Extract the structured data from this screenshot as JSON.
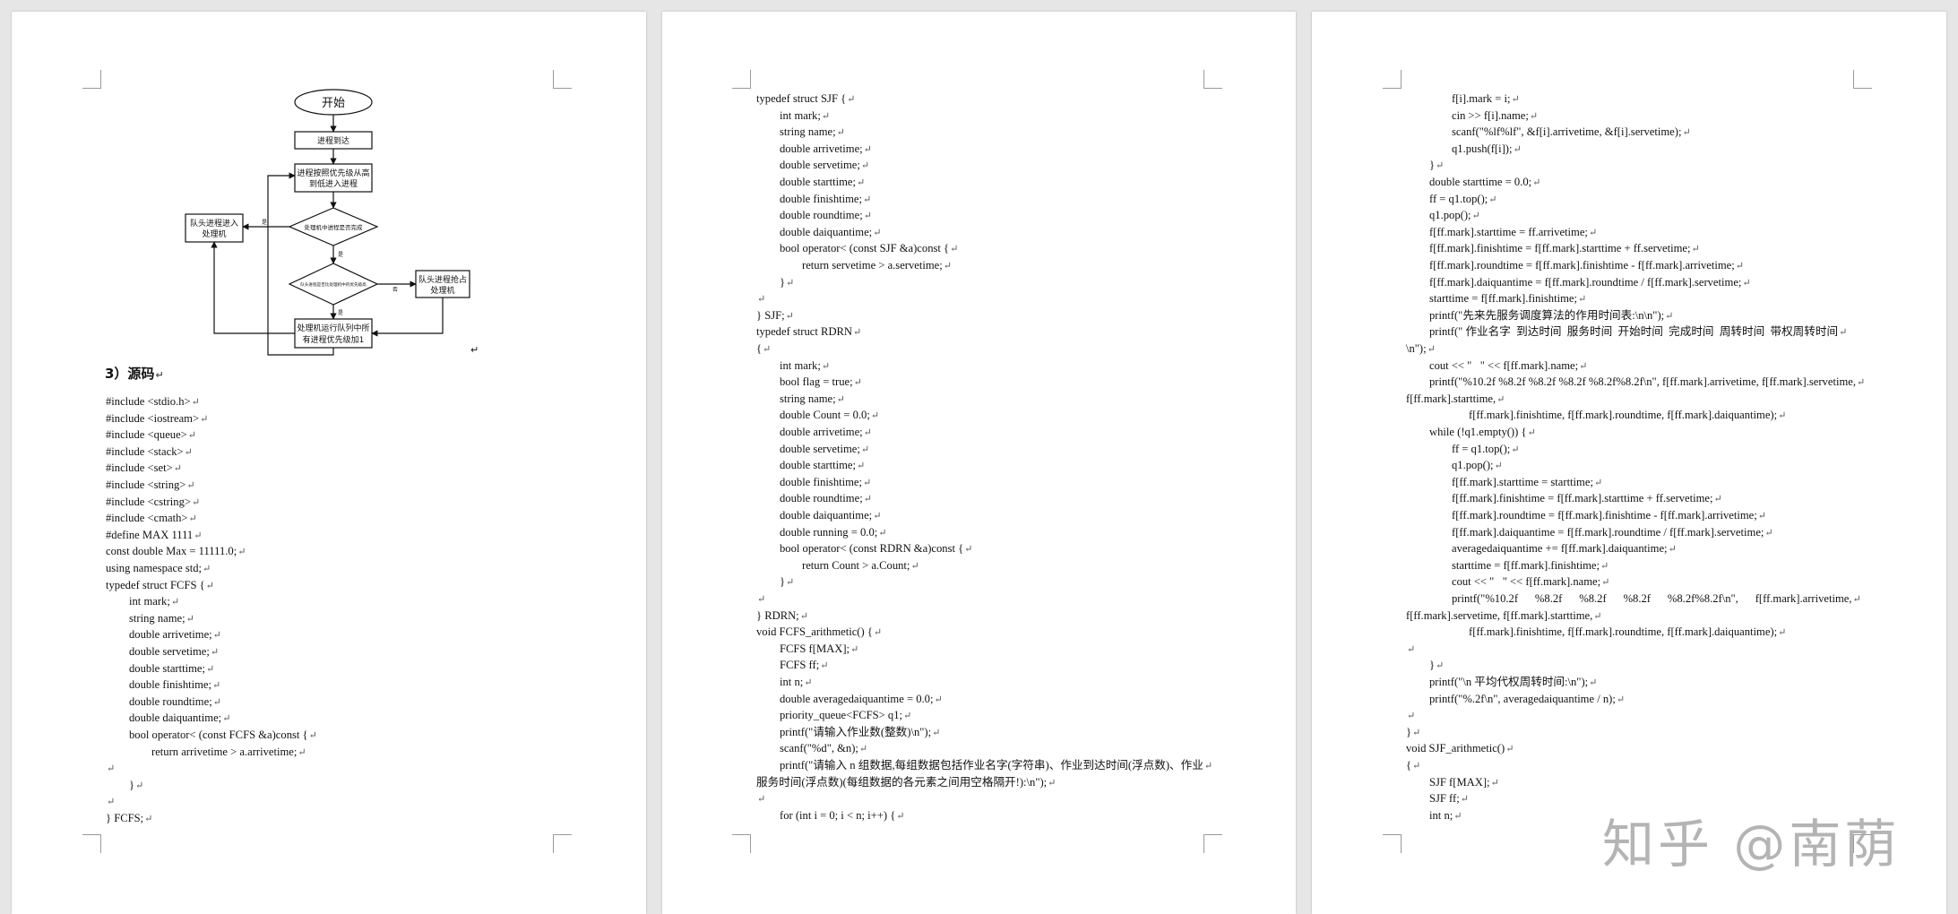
{
  "pilcrow": "↵",
  "page1": {
    "flowchart": {
      "start": "开始",
      "arrive": "进程到达",
      "enqueue_line1": "进程按照优先级从高",
      "enqueue_line2": "到低进入进程",
      "decision1": "处理机中进程是否完成",
      "head_to_cpu_line1": "队头进程进入",
      "head_to_cpu_line2": "处理机",
      "decision2": "队头进程是否比处理机中的优先级高",
      "head_preempt_line1": "队头进程抢占",
      "head_preempt_line2": "处理机",
      "running_line1": "处理机运行队列中所",
      "running_line2": "有进程优先级加1",
      "yes": "是",
      "no": "否"
    },
    "heading": "3）源码",
    "lines": [
      "#include <stdio.h>",
      "#include <iostream>",
      "#include <queue>",
      "#include <stack>",
      "#include <set>",
      "#include <string>",
      "#include <cstring>",
      "#include <cmath>",
      "#define MAX 1111",
      "const double Max = 11111.0;",
      "using namespace std;",
      "typedef struct FCFS {",
      "int mark;",
      "string name;",
      "double arrivetime;",
      "double servetime;",
      "double starttime;",
      "double finishtime;",
      "double roundtime;",
      "double daiquantime;",
      "bool operator< (const FCFS &a)const {",
      "return arrivetime > a.arrivetime;",
      "",
      "}",
      "",
      "} FCFS;"
    ]
  },
  "page2": {
    "lines": [
      "typedef struct SJF {",
      "int mark;",
      "string name;",
      "double arrivetime;",
      "double servetime;",
      "double starttime;",
      "double finishtime;",
      "double roundtime;",
      "double daiquantime;",
      "bool operator< (const SJF &a)const {",
      "return servetime > a.servetime;",
      "}",
      "",
      "} SJF;",
      "typedef struct RDRN",
      "{",
      "int mark;",
      "bool flag = true;",
      "string name;",
      "double Count = 0.0;",
      "double arrivetime;",
      "double servetime;",
      "double starttime;",
      "double finishtime;",
      "double roundtime;",
      "double daiquantime;",
      "double running = 0.0;",
      "bool operator< (const RDRN &a)const {",
      "return Count > a.Count;",
      "}",
      "",
      "} RDRN;",
      "void FCFS_arithmetic() {",
      "FCFS f[MAX];",
      "FCFS ff;",
      "int n;",
      "double averagedaiquantime = 0.0;",
      "priority_queue<FCFS> q1;",
      "printf(\"请输入作业数(整数)\\n\");",
      "scanf(\"%d\", &n);",
      "printf(\"请输入 n 组数据,每组数据包括作业名字(字符串)、作业到达时间(浮点数)、作业",
      "服务时间(浮点数)(每组数据的各元素之间用空格隔开!):\\n\");",
      "",
      "for (int i = 0; i < n; i++) {"
    ]
  },
  "page3": {
    "lines": [
      "f[i].mark = i;",
      "cin >> f[i].name;",
      "scanf(\"%lf%lf\", &f[i].arrivetime, &f[i].servetime);",
      "q1.push(f[i]);",
      "}",
      "double starttime = 0.0;",
      "ff = q1.top();",
      "q1.pop();",
      "f[ff.mark].starttime = ff.arrivetime;",
      "f[ff.mark].finishtime = f[ff.mark].starttime + ff.servetime;",
      "f[ff.mark].roundtime = f[ff.mark].finishtime - f[ff.mark].arrivetime;",
      "f[ff.mark].daiquantime = f[ff.mark].roundtime / f[ff.mark].servetime;",
      "starttime = f[ff.mark].finishtime;",
      "printf(\"先来先服务调度算法的作用时间表:\\n\\n\");",
      "printf(\" 作业名字  到达时间  服务时间  开始时间  完成时间  周转时间  带权周转时间",
      "\\n\");",
      "cout << \"   \" << f[ff.mark].name;",
      "printf(\"%10.2f %8.2f %8.2f %8.2f %8.2f%8.2f\\n\", f[ff.mark].arrivetime, f[ff.mark].servetime,",
      "f[ff.mark].starttime,",
      "f[ff.mark].finishtime, f[ff.mark].roundtime, f[ff.mark].daiquantime);",
      "while (!q1.empty()) {",
      "ff = q1.top();",
      "q1.pop();",
      "f[ff.mark].starttime = starttime;",
      "f[ff.mark].finishtime = f[ff.mark].starttime + ff.servetime;",
      "f[ff.mark].roundtime = f[ff.mark].finishtime - f[ff.mark].arrivetime;",
      "f[ff.mark].daiquantime = f[ff.mark].roundtime / f[ff.mark].servetime;",
      "averagedaiquantime += f[ff.mark].daiquantime;",
      "starttime = f[ff.mark].finishtime;",
      "cout << \"   \" << f[ff.mark].name;",
      "printf(\"%10.2f      %8.2f      %8.2f      %8.2f      %8.2f%8.2f\\n\",      f[ff.mark].arrivetime,",
      "f[ff.mark].servetime, f[ff.mark].starttime,",
      "f[ff.mark].finishtime, f[ff.mark].roundtime, f[ff.mark].daiquantime);",
      "",
      "}",
      "printf(\"\\n 平均代权周转时间:\\n\");",
      "printf(\"%.2f\\n\", averagedaiquantime / n);",
      "",
      "}",
      "void SJF_arithmetic()",
      "{",
      "SJF f[MAX];",
      "SJF ff;",
      "int n;"
    ]
  },
  "watermark": "知乎 @南荫"
}
